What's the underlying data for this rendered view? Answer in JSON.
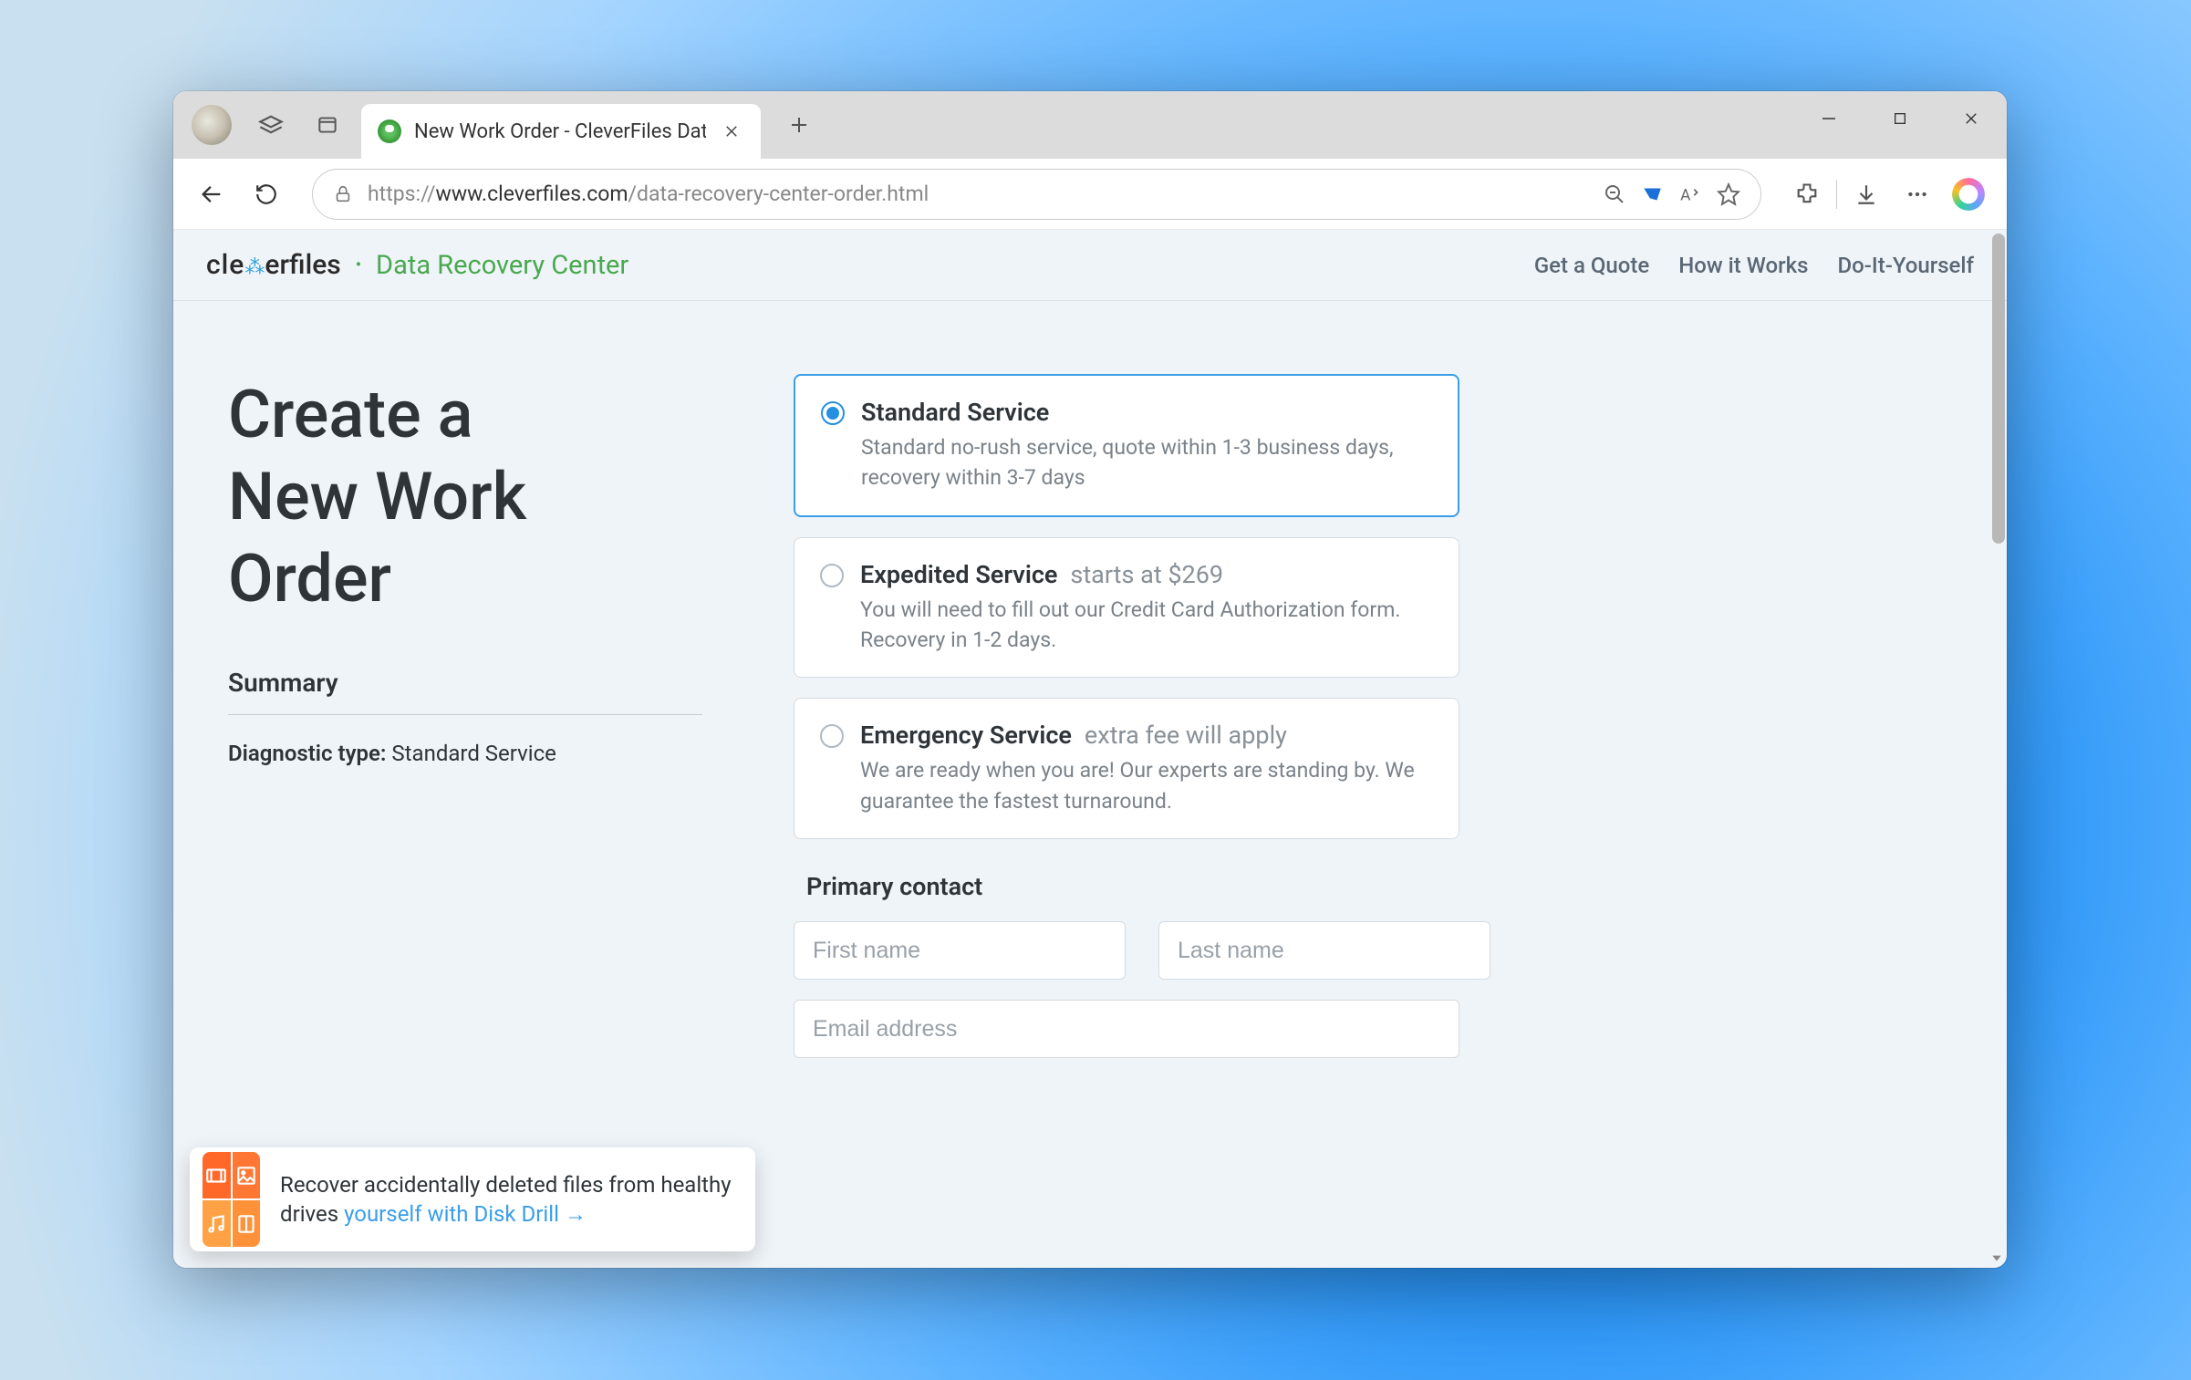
{
  "browser": {
    "tab_title": "New Work Order - CleverFiles Dat",
    "url_prefix": "https://",
    "url_host": "www.cleverfiles.com",
    "url_path": "/data-recovery-center-order.html"
  },
  "header": {
    "logo_left": "cle",
    "logo_v": "✦",
    "logo_right": "erfiles",
    "logo_suffix": "Data Recovery Center",
    "nav": {
      "quote": "Get a Quote",
      "how": "How it Works",
      "diy": "Do-It-Yourself"
    }
  },
  "page": {
    "title_l1": "Create a",
    "title_l2": "New Work",
    "title_l3": "Order",
    "summary_heading": "Summary",
    "summary_label": "Diagnostic type:",
    "summary_value": "Standard Service"
  },
  "services": {
    "standard": {
      "title": "Standard Service",
      "desc": "Standard no-rush service, quote within 1-3 business days, recovery within 3-7 days"
    },
    "expedited": {
      "title": "Expedited Service",
      "price": "starts at $269",
      "desc": "You will need to fill out our Credit Card Authorization form. Recovery in 1-2 days."
    },
    "emergency": {
      "title": "Emergency Service",
      "price": "extra fee will apply",
      "desc": "We are ready when you are! Our experts are standing by. We guarantee the fastest turnaround."
    }
  },
  "contact": {
    "heading": "Primary contact",
    "first_name_ph": "First name",
    "last_name_ph": "Last name",
    "email_ph": "Email address"
  },
  "promo": {
    "text": "Recover accidentally deleted files from healthy drives ",
    "link": "yourself with Disk Drill →"
  }
}
